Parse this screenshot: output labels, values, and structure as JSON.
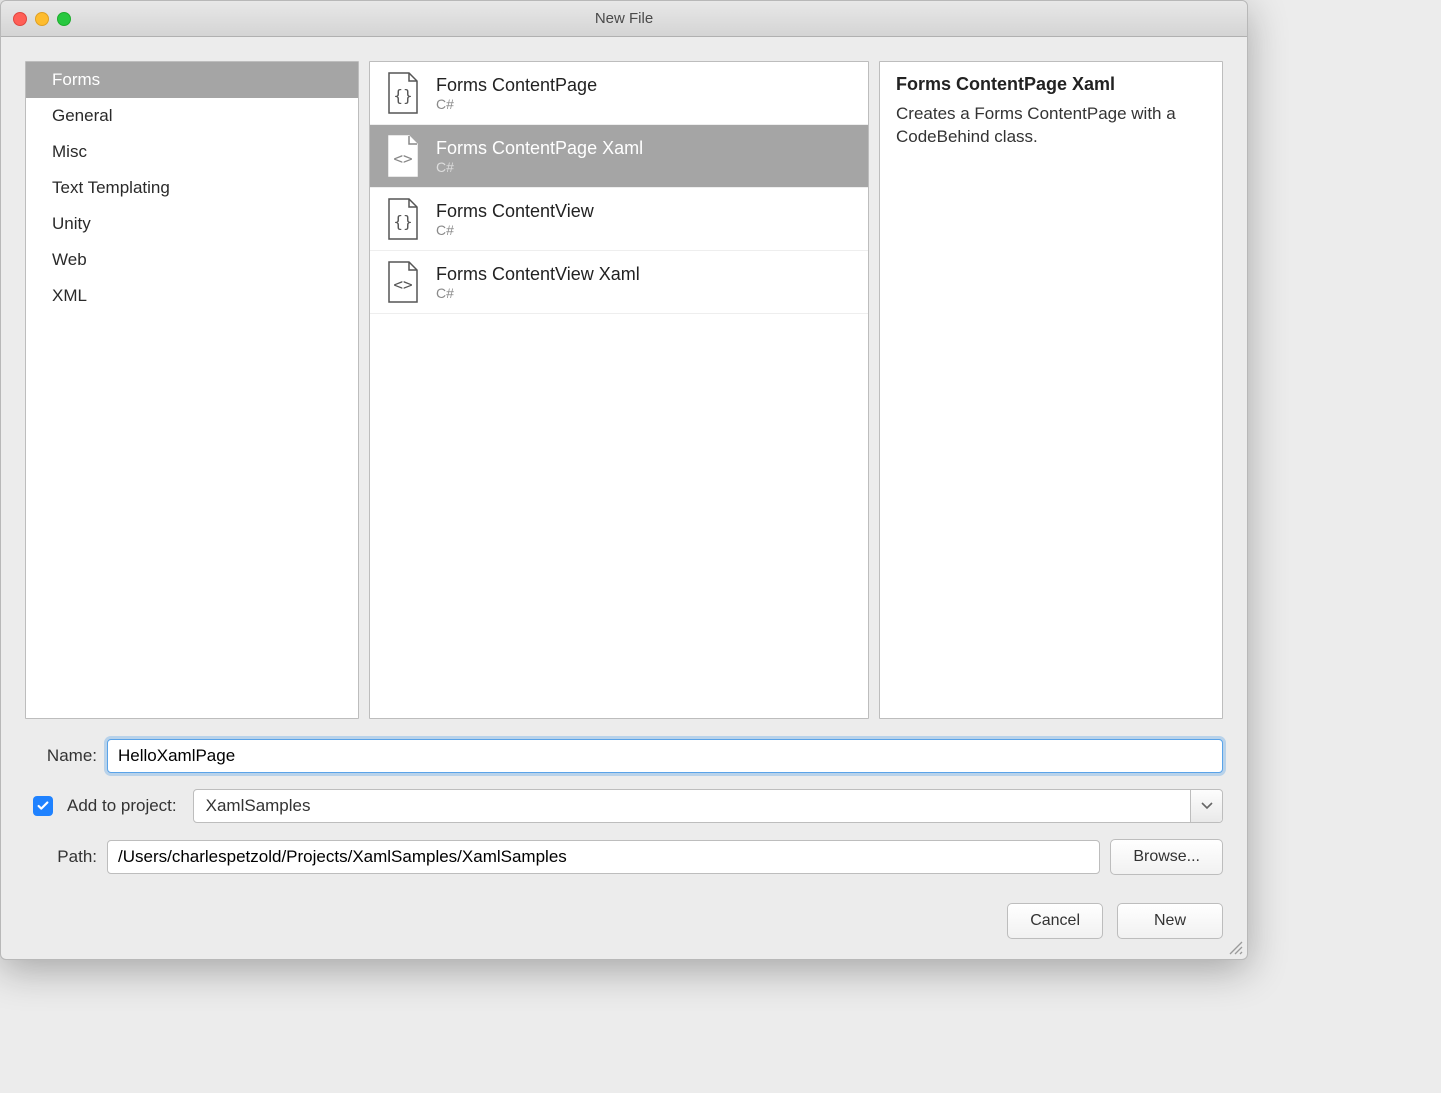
{
  "window": {
    "title": "New File"
  },
  "categories": [
    {
      "label": "Forms",
      "selected": true
    },
    {
      "label": "General",
      "selected": false
    },
    {
      "label": "Misc",
      "selected": false
    },
    {
      "label": "Text Templating",
      "selected": false
    },
    {
      "label": "Unity",
      "selected": false
    },
    {
      "label": "Web",
      "selected": false
    },
    {
      "label": "XML",
      "selected": false
    }
  ],
  "templates": [
    {
      "title": "Forms ContentPage",
      "subtitle": "C#",
      "icon": "braces",
      "selected": false
    },
    {
      "title": "Forms ContentPage Xaml",
      "subtitle": "C#",
      "icon": "angles",
      "selected": true
    },
    {
      "title": "Forms ContentView",
      "subtitle": "C#",
      "icon": "braces",
      "selected": false
    },
    {
      "title": "Forms ContentView Xaml",
      "subtitle": "C#",
      "icon": "angles",
      "selected": false
    }
  ],
  "description": {
    "title": "Forms ContentPage Xaml",
    "body": "Creates a Forms ContentPage with a CodeBehind class."
  },
  "form": {
    "name_label": "Name:",
    "name_value": "HelloXamlPage",
    "add_to_project_label": "Add to project:",
    "project_selected": "XamlSamples",
    "path_label": "Path:",
    "path_value": "/Users/charlespetzold/Projects/XamlSamples/XamlSamples",
    "browse_label": "Browse...",
    "add_to_project_checked": true
  },
  "buttons": {
    "cancel": "Cancel",
    "new": "New"
  }
}
